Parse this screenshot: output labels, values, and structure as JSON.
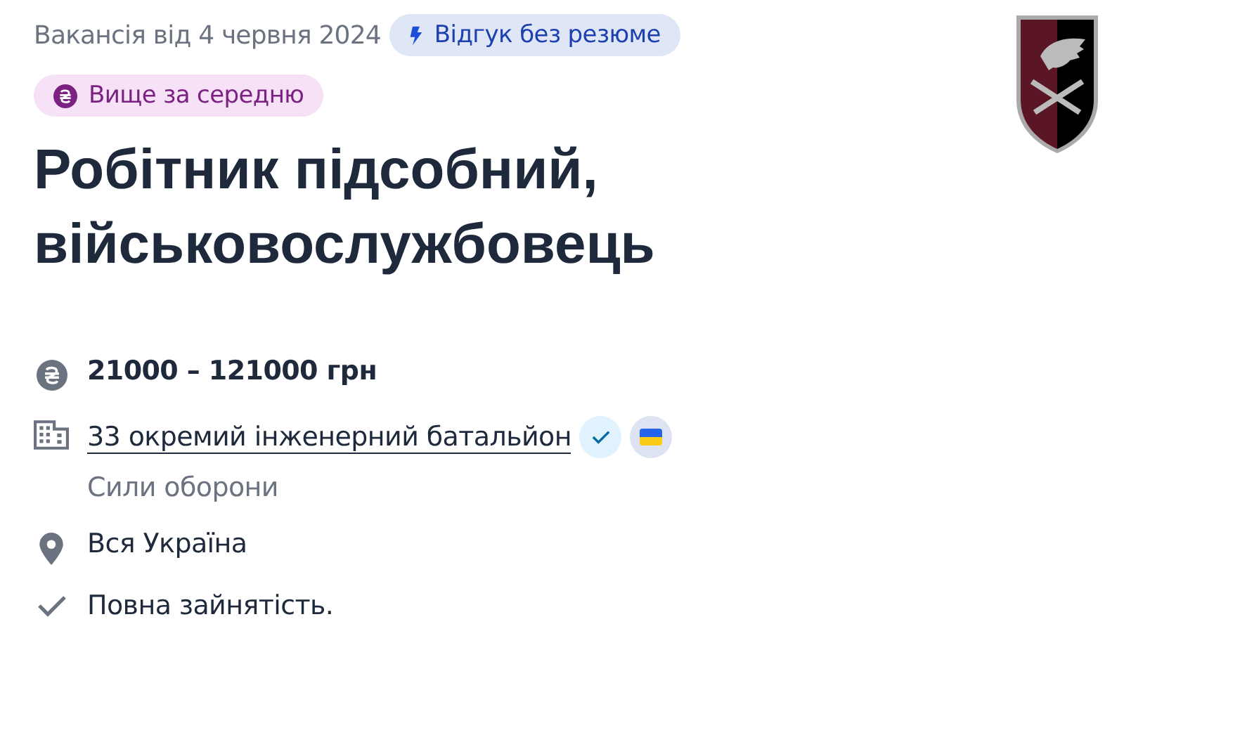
{
  "posted": "Вакансія від 4 червня 2024",
  "tags": [
    {
      "kind": "quick-apply",
      "label": "Відгук без резюме"
    },
    {
      "kind": "salary-level",
      "label": "Вище за середню"
    }
  ],
  "title": "Робітник підсобний, військовослужбовець",
  "details": [
    {
      "kind": "salary",
      "text": "21000 – 121000 грн"
    },
    {
      "kind": "company",
      "text": "33 окремий інженерний батальйон",
      "subtitle": "Сили оборони",
      "verified": true,
      "ua_flag": true
    },
    {
      "kind": "location",
      "text": "Вся Україна"
    },
    {
      "kind": "employment",
      "text": "Повна зайнятість."
    }
  ]
}
